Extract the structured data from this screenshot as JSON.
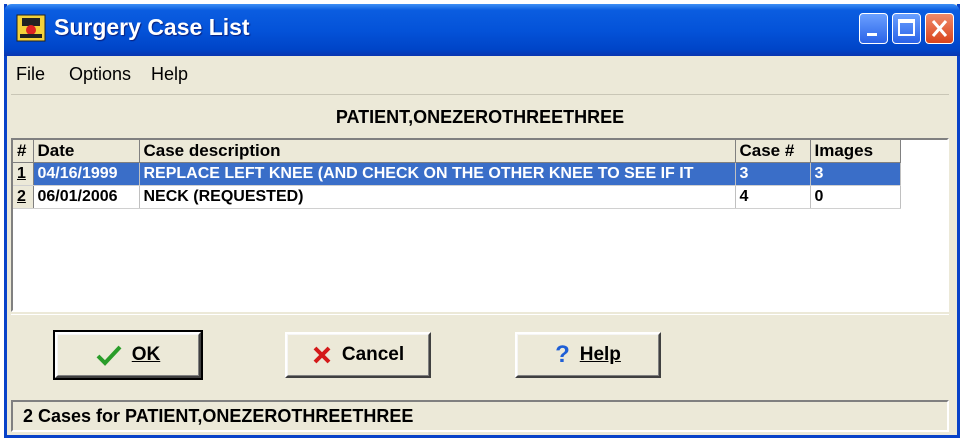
{
  "window": {
    "title": "Surgery Case List",
    "icon": "surgery-case-app-icon"
  },
  "menu": [
    {
      "label": "File"
    },
    {
      "label": "Options"
    },
    {
      "label": "Help"
    }
  ],
  "patient": {
    "name": "PATIENT,ONEZEROTHREETHREE"
  },
  "table": {
    "columns": [
      "#",
      "Date",
      "Case description",
      "Case #",
      "Images"
    ],
    "rows": [
      {
        "num": "1",
        "date": "04/16/1999",
        "description": "REPLACE LEFT KNEE (AND CHECK ON THE OTHER KNEE TO SEE IF IT",
        "case": "3",
        "images": "3",
        "selected": true
      },
      {
        "num": "2",
        "date": "06/01/2006",
        "description": "NECK (REQUESTED)",
        "case": "4",
        "images": "0",
        "selected": false
      }
    ]
  },
  "buttons": {
    "ok": "OK",
    "cancel": "Cancel",
    "help": "Help"
  },
  "status": {
    "text": "2 Cases for PATIENT,ONEZEROTHREETHREE"
  },
  "colors": {
    "titlebar": "#0453d9",
    "selection": "#3a6ec8",
    "face": "#ece9d8"
  }
}
